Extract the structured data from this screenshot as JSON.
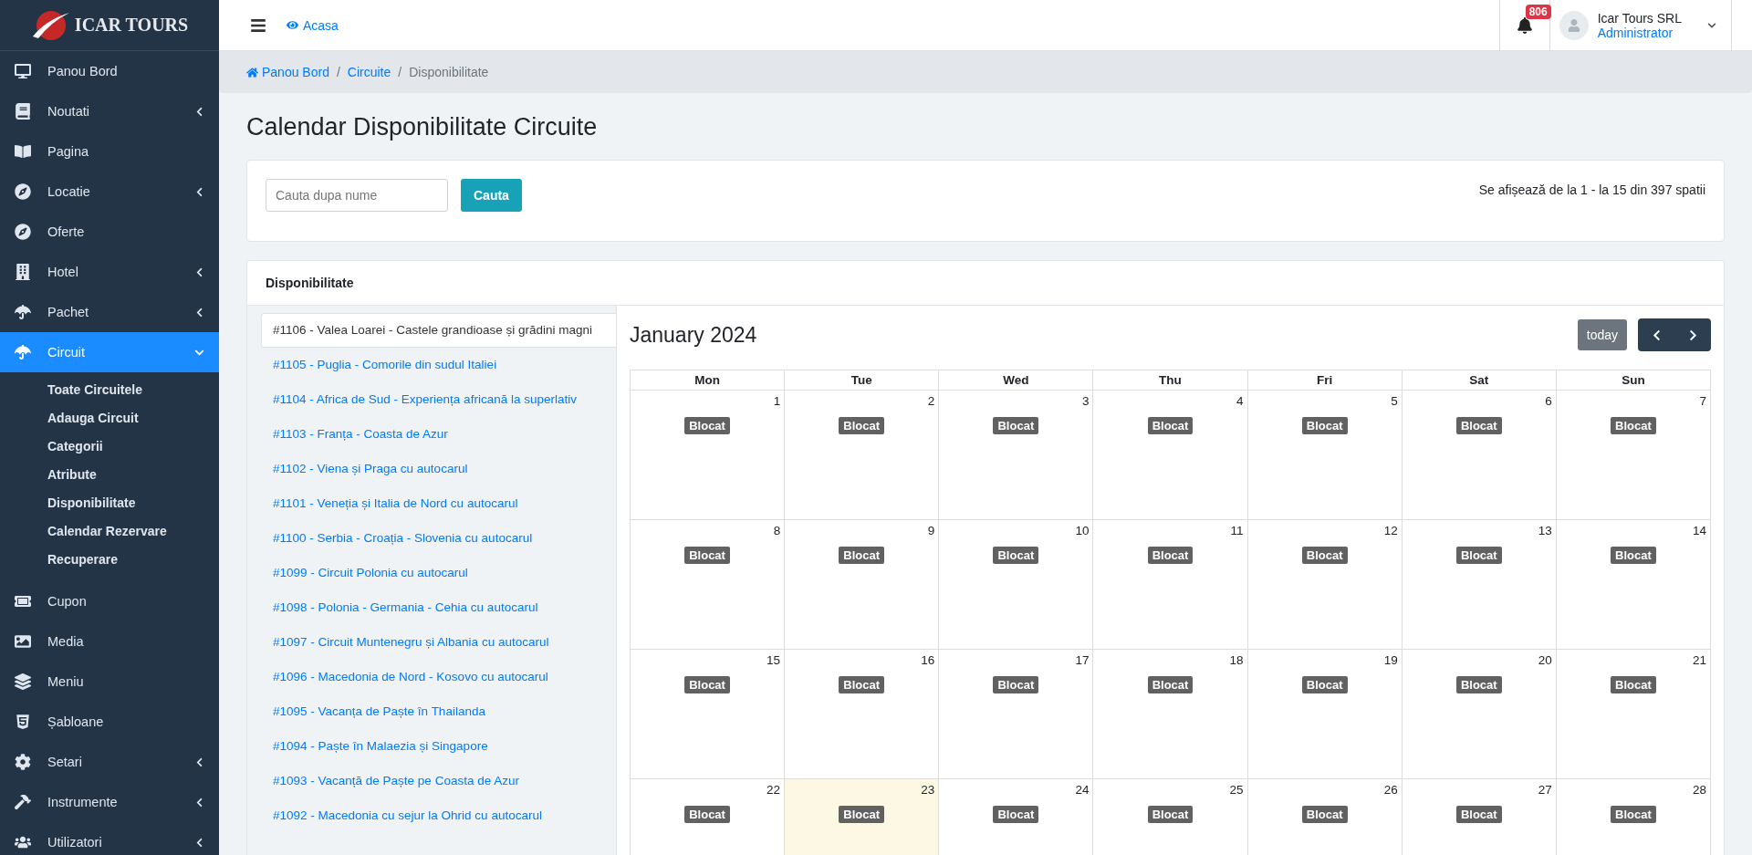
{
  "logo": {
    "text": "ICAR TOURS"
  },
  "sidebar": {
    "items": [
      {
        "label": "Panou Bord",
        "kind": "link",
        "selected": false
      },
      {
        "label": "Noutati",
        "kind": "group",
        "selected": false,
        "expanded": false
      },
      {
        "label": "Pagina",
        "kind": "link",
        "selected": false
      },
      {
        "label": "Locatie",
        "kind": "group",
        "selected": false,
        "expanded": false
      },
      {
        "label": "Oferte",
        "kind": "link",
        "selected": false
      },
      {
        "label": "Hotel",
        "kind": "group",
        "selected": false,
        "expanded": false
      },
      {
        "label": "Pachet",
        "kind": "group",
        "selected": false,
        "expanded": false
      },
      {
        "label": "Circuit",
        "kind": "group",
        "selected": true,
        "expanded": true,
        "children": [
          {
            "label": "Toate Circuitele"
          },
          {
            "label": "Adauga Circuit"
          },
          {
            "label": "Categorii"
          },
          {
            "label": "Atribute"
          },
          {
            "label": "Disponibilitate"
          },
          {
            "label": "Calendar Rezervare"
          },
          {
            "label": "Recuperare"
          }
        ]
      },
      {
        "label": "Cupon",
        "kind": "link",
        "selected": false
      },
      {
        "label": "Media",
        "kind": "link",
        "selected": false
      },
      {
        "label": "Meniu",
        "kind": "link",
        "selected": false
      },
      {
        "label": "Șabloane",
        "kind": "link",
        "selected": false
      },
      {
        "label": "Setari",
        "kind": "group",
        "selected": false,
        "expanded": false
      },
      {
        "label": "Instrumente",
        "kind": "group",
        "selected": false,
        "expanded": false
      },
      {
        "label": "Utilizatori",
        "kind": "group",
        "selected": false,
        "expanded": false
      }
    ]
  },
  "topbar": {
    "home_link": "Acasa",
    "notifications": "806",
    "user": {
      "name": "Icar Tours SRL",
      "role": "Administrator"
    }
  },
  "breadcrumb_separator": "/",
  "breadcrumb": [
    {
      "label": "Panou Bord",
      "link": true
    },
    {
      "label": "Circuite",
      "link": true
    },
    {
      "label": "Disponibilitate",
      "link": false
    }
  ],
  "page_title": "Calendar Disponibilitate Circuite",
  "search": {
    "placeholder": "Cauta dupa nume",
    "button": "Cauta",
    "summary": "Se afișează de la 1 - la 15 din 397 spatii"
  },
  "availability": {
    "title": "Disponibilitate",
    "circuits": [
      {
        "label": "#1106 - Valea Loarei - Castele grandioase și grădini magni",
        "selected": true
      },
      {
        "label": "#1105 - Puglia - Comorile din sudul Italiei",
        "selected": false
      },
      {
        "label": "#1104 - Africa de Sud - Experiența africană la superlativ",
        "selected": false
      },
      {
        "label": "#1103 - Franța - Coasta de Azur",
        "selected": false
      },
      {
        "label": "#1102 - Viena și Praga cu autocarul",
        "selected": false
      },
      {
        "label": "#1101 - Veneția și Italia de Nord cu autocarul",
        "selected": false
      },
      {
        "label": "#1100 - Serbia - Croația - Slovenia cu autocarul",
        "selected": false
      },
      {
        "label": "#1099 - Circuit Polonia cu autocarul",
        "selected": false
      },
      {
        "label": "#1098 - Polonia - Germania - Cehia cu autocarul",
        "selected": false
      },
      {
        "label": "#1097 - Circuit Muntenegru și Albania cu autocarul",
        "selected": false
      },
      {
        "label": "#1096 - Macedonia de Nord - Kosovo cu autocarul",
        "selected": false
      },
      {
        "label": "#1095 - Vacanța de Paște în Thailanda",
        "selected": false
      },
      {
        "label": "#1094 - Paște în Malaezia și Singapore",
        "selected": false
      },
      {
        "label": "#1093 - Vacanță de Paște pe Coasta de Azur",
        "selected": false
      },
      {
        "label": "#1092 - Macedonia cu sejur la Ohrid cu autocarul",
        "selected": false
      }
    ],
    "calendar": {
      "month": "January 2024",
      "today_button": "today",
      "weekdays": [
        "Mon",
        "Tue",
        "Wed",
        "Thu",
        "Fri",
        "Sat",
        "Sun"
      ],
      "weeks": [
        [
          {
            "date": "1",
            "today": false,
            "events": [
              "Blocat"
            ]
          },
          {
            "date": "2",
            "today": false,
            "events": [
              "Blocat"
            ]
          },
          {
            "date": "3",
            "today": false,
            "events": [
              "Blocat"
            ]
          },
          {
            "date": "4",
            "today": false,
            "events": [
              "Blocat"
            ]
          },
          {
            "date": "5",
            "today": false,
            "events": [
              "Blocat"
            ]
          },
          {
            "date": "6",
            "today": false,
            "events": [
              "Blocat"
            ]
          },
          {
            "date": "7",
            "today": false,
            "events": [
              "Blocat"
            ]
          }
        ],
        [
          {
            "date": "8",
            "today": false,
            "events": [
              "Blocat"
            ]
          },
          {
            "date": "9",
            "today": false,
            "events": [
              "Blocat"
            ]
          },
          {
            "date": "10",
            "today": false,
            "events": [
              "Blocat"
            ]
          },
          {
            "date": "11",
            "today": false,
            "events": [
              "Blocat"
            ]
          },
          {
            "date": "12",
            "today": false,
            "events": [
              "Blocat"
            ]
          },
          {
            "date": "13",
            "today": false,
            "events": [
              "Blocat"
            ]
          },
          {
            "date": "14",
            "today": false,
            "events": [
              "Blocat"
            ]
          }
        ],
        [
          {
            "date": "15",
            "today": false,
            "events": [
              "Blocat"
            ]
          },
          {
            "date": "16",
            "today": false,
            "events": [
              "Blocat"
            ]
          },
          {
            "date": "17",
            "today": false,
            "events": [
              "Blocat"
            ]
          },
          {
            "date": "18",
            "today": false,
            "events": [
              "Blocat"
            ]
          },
          {
            "date": "19",
            "today": false,
            "events": [
              "Blocat"
            ]
          },
          {
            "date": "20",
            "today": false,
            "events": [
              "Blocat"
            ]
          },
          {
            "date": "21",
            "today": false,
            "events": [
              "Blocat"
            ]
          }
        ],
        [
          {
            "date": "22",
            "today": false,
            "events": [
              "Blocat"
            ]
          },
          {
            "date": "23",
            "today": true,
            "events": [
              "Blocat"
            ]
          },
          {
            "date": "24",
            "today": false,
            "events": [
              "Blocat"
            ]
          },
          {
            "date": "25",
            "today": false,
            "events": [
              "Blocat"
            ]
          },
          {
            "date": "26",
            "today": false,
            "events": [
              "Blocat"
            ]
          },
          {
            "date": "27",
            "today": false,
            "events": [
              "Blocat"
            ]
          },
          {
            "date": "28",
            "today": false,
            "events": [
              "Blocat"
            ]
          }
        ]
      ]
    }
  }
}
